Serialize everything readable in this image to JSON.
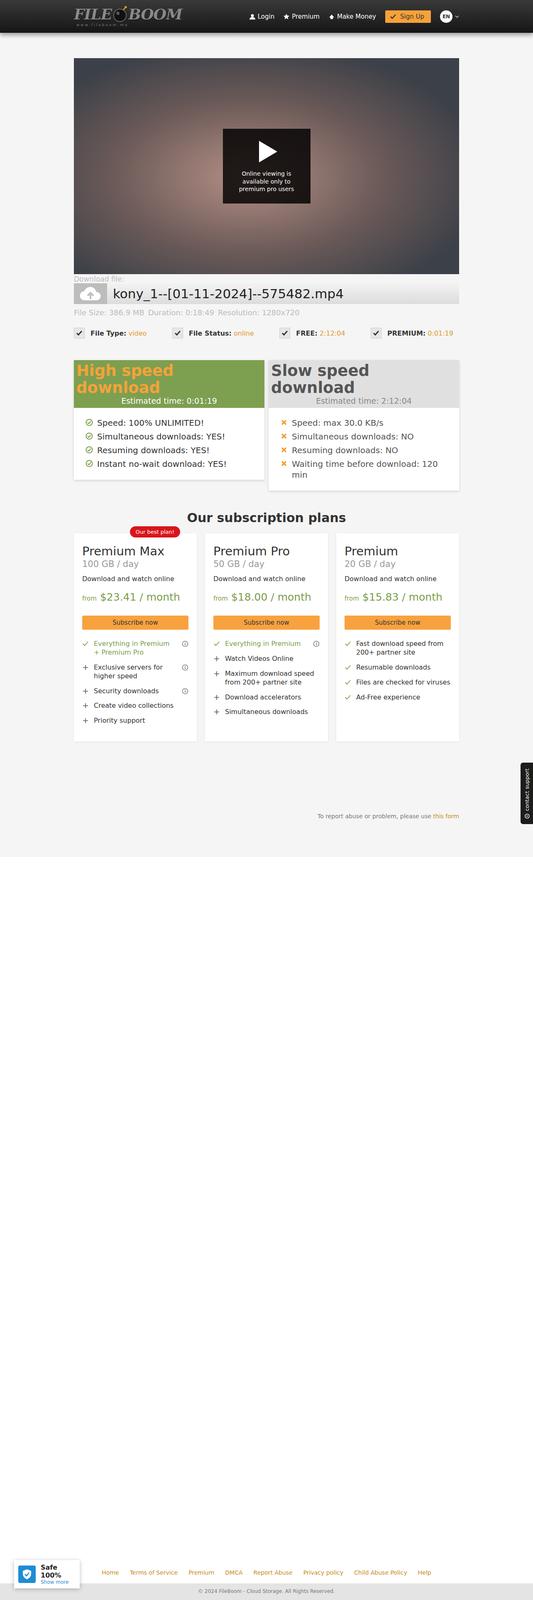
{
  "header": {
    "logo": {
      "first": "FILE",
      "second": "BOOM",
      "tagline": "www.fileboom.me"
    },
    "nav": [
      {
        "label": "Login",
        "icon": "user"
      },
      {
        "label": "Premium",
        "icon": "star"
      },
      {
        "label": "Make Money",
        "icon": "money"
      }
    ],
    "signup": "Sign Up",
    "language": "EN"
  },
  "video": {
    "overlay": "Online viewing is available only to premium pro users"
  },
  "file": {
    "label": "Download file:",
    "name": "kony_1--[01-11-2024]--575482.mp4",
    "meta": [
      "File Size: 386.9 MB",
      "Duration: 0:18:49",
      "Resolution: 1280x720"
    ],
    "facts": [
      {
        "label": "File Type:",
        "value": "video",
        "checked": true
      },
      {
        "label": "File Status:",
        "value": "online",
        "checked": true
      },
      {
        "label": "FREE:",
        "value": "2:12:04",
        "checked": true
      },
      {
        "label": "PREMIUM:",
        "value": "0:01:19",
        "checked": true
      }
    ]
  },
  "downloads": [
    {
      "kind": "fast",
      "title": "High speed download",
      "estimate": "Estimated time: 0:01:19",
      "features": [
        "Speed: 100% UNLIMITED!",
        "Simultaneous downloads: YES!",
        "Resuming downloads: YES!",
        "Instant no-wait download: YES!"
      ]
    },
    {
      "kind": "slow",
      "title": "Slow speed download",
      "estimate": "Estimated time: 2:12:04",
      "features": [
        "Speed: max 30.0 KB/s",
        "Simultaneous downloads: NO",
        "Resuming downloads: NO",
        "Waiting time before download: 120 min"
      ]
    }
  ],
  "plans": {
    "heading": "Our subscription plans",
    "items": [
      {
        "name": "Premium Max",
        "quota": "100 GB / day",
        "desc": "Download and watch online",
        "from": "from",
        "price": "$23.41 / month",
        "button": "Subscribe now",
        "badge": "Our best plan!",
        "features": [
          {
            "text": "Everything in Premium + Premium Pro",
            "kind": "included",
            "highlight": true,
            "info": true
          },
          {
            "text": "Exclusive servers for higher speed",
            "kind": "extra",
            "highlight": false,
            "info": true
          },
          {
            "text": "Security downloads",
            "kind": "extra",
            "highlight": false,
            "info": true
          },
          {
            "text": "Create video collections",
            "kind": "extra",
            "highlight": false,
            "info": false
          },
          {
            "text": "Priority support",
            "kind": "extra",
            "highlight": false,
            "info": false
          }
        ]
      },
      {
        "name": "Premium Pro",
        "quota": "50 GB / day",
        "desc": "Download and watch online",
        "from": "from",
        "price": "$18.00 / month",
        "button": "Subscribe now",
        "badge": "",
        "features": [
          {
            "text": "Everything in Premium",
            "kind": "included",
            "highlight": true,
            "info": true
          },
          {
            "text": "Watch Videos Online",
            "kind": "extra",
            "highlight": false,
            "info": false
          },
          {
            "text": "Maximum download speed from 200+ partner site",
            "kind": "extra",
            "highlight": false,
            "info": false
          },
          {
            "text": "Download accelerators",
            "kind": "extra",
            "highlight": false,
            "info": false
          },
          {
            "text": "Simultaneous downloads",
            "kind": "extra",
            "highlight": false,
            "info": false
          }
        ]
      },
      {
        "name": "Premium",
        "quota": "20 GB / day",
        "desc": "Download and watch online",
        "from": "from",
        "price": "$15.83 / month",
        "button": "Subscribe now",
        "badge": "",
        "features": [
          {
            "text": "Fast download speed from 200+ partner site",
            "kind": "included",
            "highlight": false,
            "info": false
          },
          {
            "text": "Resumable downloads",
            "kind": "included",
            "highlight": false,
            "info": false
          },
          {
            "text": "Files are checked for viruses",
            "kind": "included",
            "highlight": false,
            "info": false
          },
          {
            "text": "Ad-Free experience",
            "kind": "included",
            "highlight": false,
            "info": false
          }
        ]
      }
    ]
  },
  "report": {
    "text": "To report abuse or problem, please use",
    "link": "this form"
  },
  "support": "contact support",
  "footer": {
    "links": [
      "Home",
      "Terms of Service",
      "Premium",
      "DMCA",
      "Report Abuse",
      "Privacy policy",
      "Child Abuse Policy",
      "Help"
    ],
    "copyright": "© 2024 FileBoom - Cloud Storage. All Rights Reserved."
  },
  "safe": {
    "title": "Safe 100%",
    "link": "Show more"
  }
}
